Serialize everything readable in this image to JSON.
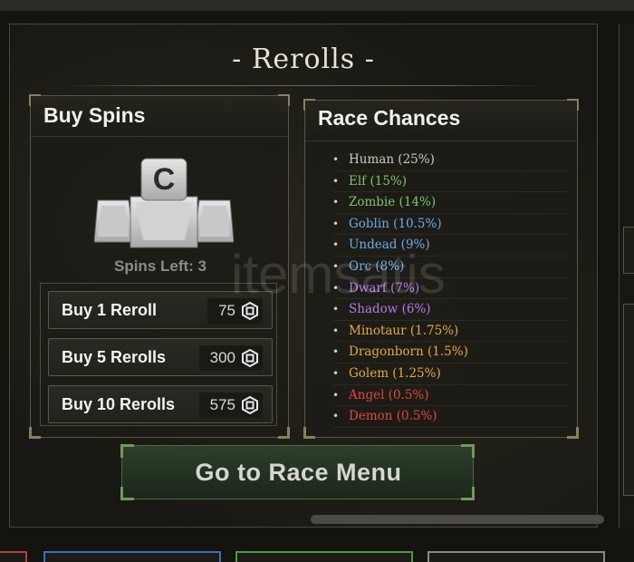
{
  "title": "- Rerolls -",
  "buy_spins": {
    "title": "Buy Spins",
    "icon": "spin-token-icon",
    "spins_left": "Spins Left: 3",
    "options": [
      {
        "label": "Buy 1 Reroll",
        "price": "75"
      },
      {
        "label": "Buy 5 Rerolls",
        "price": "300"
      },
      {
        "label": "Buy 10 Rerolls",
        "price": "575"
      }
    ],
    "currency_icon": "robux-coin-icon"
  },
  "race_chances": {
    "title": "Race Chances",
    "races": [
      {
        "label": "Human (25%)",
        "color": "#c9c9c9"
      },
      {
        "label": "Elf (15%)",
        "color": "#7fc46a"
      },
      {
        "label": "Zombie (14%)",
        "color": "#7fc46a"
      },
      {
        "label": "Goblin (10.5%)",
        "color": "#6aaee8"
      },
      {
        "label": "Undead (9%)",
        "color": "#6aaee8"
      },
      {
        "label": "Orc (8%)",
        "color": "#6aaee8"
      },
      {
        "label": "Dwarf (7%)",
        "color": "#b77ae8"
      },
      {
        "label": "Shadow (6%)",
        "color": "#b77ae8"
      },
      {
        "label": "Minotaur (1.75%)",
        "color": "#e6a83c"
      },
      {
        "label": "Dragonborn (1.5%)",
        "color": "#e6a83c"
      },
      {
        "label": "Golem (1.25%)",
        "color": "#e6a83c"
      },
      {
        "label": "Angel (0.5%)",
        "color": "#e2463e"
      },
      {
        "label": "Demon (0.5%)",
        "color": "#e2463e"
      }
    ]
  },
  "go_button": "Go to Race Menu",
  "watermark": "itemsatis",
  "colors": {
    "accent_green": "#2f3f2a",
    "frame_gold": "#8a7f5c"
  }
}
